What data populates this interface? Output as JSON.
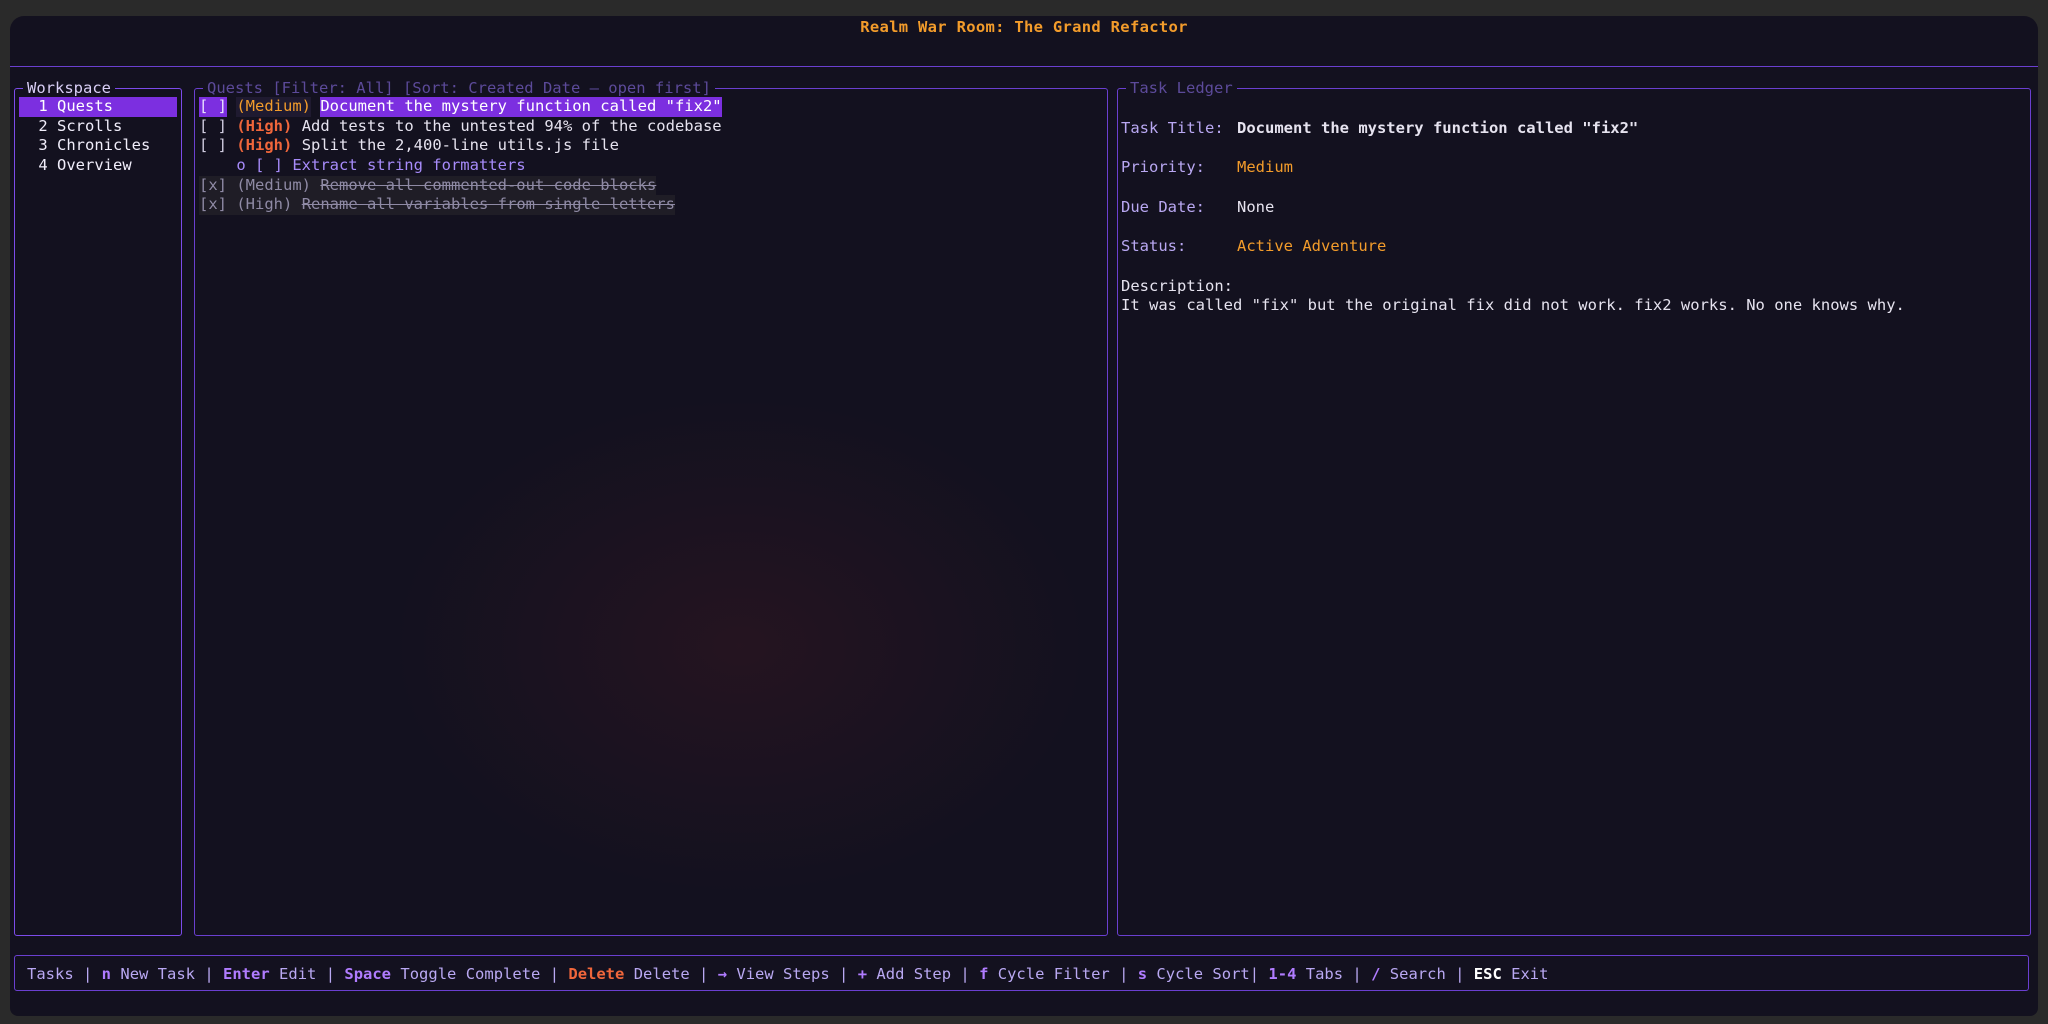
{
  "app": {
    "title": "Realm War Room: The Grand Refactor"
  },
  "workspace": {
    "title": "Workspace",
    "items": [
      {
        "label": " 1 Quests"
      },
      {
        "label": " 2 Scrolls"
      },
      {
        "label": " 3 Chronicles"
      },
      {
        "label": " 4 Overview"
      }
    ],
    "active_index": 0
  },
  "quests": {
    "title": "Quests [Filter: All] [Sort: Created Date — open first]",
    "rows": [
      {
        "checkbox": "[ ]",
        "priority": "(Medium)",
        "text": "Document the mystery function called \"fix2\"",
        "selected": true,
        "done": false
      },
      {
        "checkbox": "[ ]",
        "priority": "(High)",
        "text": "Add tests to the untested 94% of the codebase",
        "selected": false,
        "done": false
      },
      {
        "checkbox": "[ ]",
        "priority": "(High)",
        "text": "Split the 2,400-line utils.js file",
        "selected": false,
        "done": false
      },
      {
        "step": "o [ ] Extract string formatters"
      },
      {
        "checkbox": "[x]",
        "priority": "(Medium)",
        "text": "Remove all commented-out code blocks",
        "selected": false,
        "done": true
      },
      {
        "checkbox": "[x]",
        "priority": "(High)",
        "text": "Rename all variables from single letters",
        "selected": false,
        "done": true
      }
    ]
  },
  "ledger": {
    "title": "Task Ledger",
    "task_title_label": "Task Title:",
    "task_title_value": "Document the mystery function called \"fix2\"",
    "priority_label": "Priority:",
    "priority_value": "Medium",
    "due_label": "Due Date:",
    "due_value": "None",
    "status_label": "Status:",
    "status_value": "Active Adventure",
    "description_label": "Description:",
    "description_value": "It was called \"fix\" but the original fix did not work. fix2 works. No one knows why."
  },
  "footer": {
    "label": "Tasks",
    "shortcuts": [
      {
        "key": "n",
        "action": "New Task"
      },
      {
        "key": "Enter",
        "action": "Edit"
      },
      {
        "key": "Space",
        "action": "Toggle Complete"
      },
      {
        "key": "Delete",
        "action": "Delete"
      },
      {
        "key": "→",
        "action": "View Steps"
      },
      {
        "key": "+",
        "action": "Add Step"
      },
      {
        "key": "f",
        "action": "Cycle Filter"
      },
      {
        "key": "s",
        "action": "Cycle Sort"
      },
      {
        "key": "1-4",
        "action": "Tabs"
      },
      {
        "key": "/",
        "action": "Search"
      },
      {
        "key": "ESC",
        "action": "Exit"
      }
    ]
  },
  "colors": {
    "background": "#13111f",
    "border": "#6a3fd0",
    "accent": "#7c2fe0",
    "orange": "#f39c2b",
    "high": "#f0663b"
  }
}
